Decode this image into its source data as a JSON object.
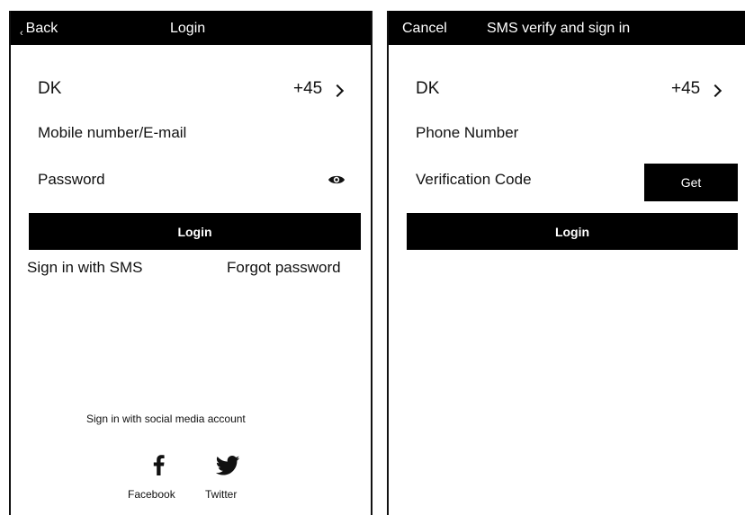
{
  "login_screen": {
    "back_label": "Back",
    "title": "Login",
    "country": "DK",
    "dial_code": "+45",
    "account_placeholder": "Mobile number/E-mail",
    "password_placeholder": "Password",
    "login_button": "Login",
    "sms_link": "Sign in with SMS",
    "forgot_link": "Forgot password",
    "social_title": "Sign in with social media account",
    "social": [
      {
        "label": "Facebook",
        "icon": "facebook-icon"
      },
      {
        "label": "Twitter",
        "icon": "twitter-icon"
      }
    ]
  },
  "sms_screen": {
    "cancel_label": "Cancel",
    "title": "SMS verify and sign in",
    "country": "DK",
    "dial_code": "+45",
    "phone_placeholder": "Phone Number",
    "code_placeholder": "Verification Code",
    "get_button": "Get",
    "login_button": "Login"
  },
  "colors": {
    "bar": "#000000",
    "button": "#000000",
    "text": "#111111",
    "background": "#ffffff"
  }
}
